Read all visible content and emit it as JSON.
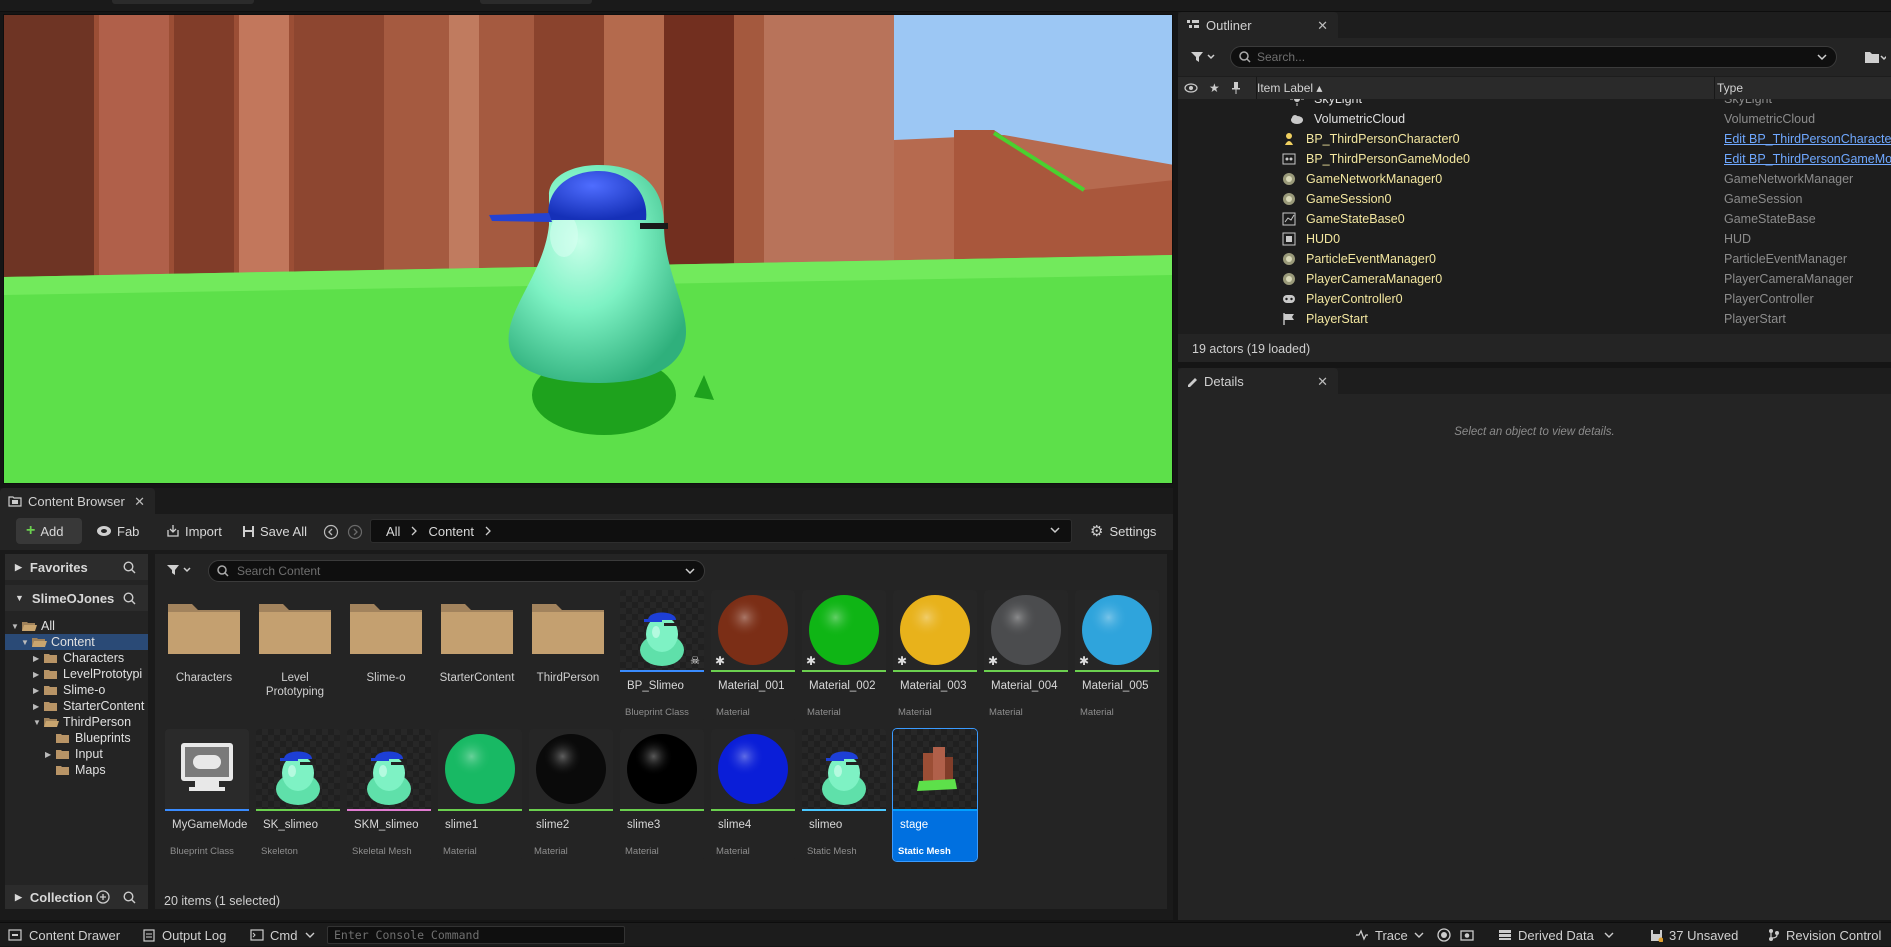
{
  "outliner": {
    "tab_label": "Outliner",
    "search_placeholder": "Search...",
    "col_item_label": "Item Label",
    "col_type": "Type",
    "rows": [
      {
        "label": "SkyLight",
        "type": "SkyLight",
        "icon": "skylight-icon"
      },
      {
        "label": "VolumetricCloud",
        "type": "VolumetricCloud",
        "icon": "cloud-icon"
      },
      {
        "label": "BP_ThirdPersonCharacter0",
        "type": "Edit BP_ThirdPersonCharacte",
        "icon": "pawn-icon",
        "link": true
      },
      {
        "label": "BP_ThirdPersonGameMode0",
        "type": "Edit BP_ThirdPersonGameMo",
        "icon": "gamemode-icon",
        "link": true
      },
      {
        "label": "GameNetworkManager0",
        "type": "GameNetworkManager",
        "icon": "actor-icon"
      },
      {
        "label": "GameSession0",
        "type": "GameSession",
        "icon": "actor-icon"
      },
      {
        "label": "GameStateBase0",
        "type": "GameStateBase",
        "icon": "gamestate-icon"
      },
      {
        "label": "HUD0",
        "type": "HUD",
        "icon": "hud-icon"
      },
      {
        "label": "ParticleEventManager0",
        "type": "ParticleEventManager",
        "icon": "actor-icon"
      },
      {
        "label": "PlayerCameraManager0",
        "type": "PlayerCameraManager",
        "icon": "actor-icon"
      },
      {
        "label": "PlayerController0",
        "type": "PlayerController",
        "icon": "gamepad-icon"
      },
      {
        "label": "PlayerStart",
        "type": "PlayerStart",
        "icon": "flag-icon"
      }
    ],
    "status": "19 actors (19 loaded)"
  },
  "details": {
    "tab_label": "Details",
    "empty_text": "Select an object to view details."
  },
  "content_browser": {
    "tab_label": "Content Browser",
    "add_label": "Add",
    "fab_label": "Fab",
    "import_label": "Import",
    "save_all_label": "Save All",
    "settings_label": "Settings",
    "path": [
      "All",
      "Content"
    ],
    "favorites_label": "Favorites",
    "project_label": "SlimeOJones",
    "collection_label": "Collection",
    "search_placeholder": "Search Content",
    "tree": [
      {
        "label": "All"
      },
      {
        "label": "Content"
      },
      {
        "label": "Characters"
      },
      {
        "label": "LevelPrototypi"
      },
      {
        "label": "Slime-o"
      },
      {
        "label": "StarterContent"
      },
      {
        "label": "ThirdPerson"
      },
      {
        "label": "Blueprints"
      },
      {
        "label": "Input"
      },
      {
        "label": "Maps"
      }
    ],
    "folders": [
      {
        "name": "Characters"
      },
      {
        "name": "Level Prototyping"
      },
      {
        "name": "Slime-o"
      },
      {
        "name": "StarterContent"
      },
      {
        "name": "ThirdPerson"
      }
    ],
    "assets_row1": [
      {
        "name": "BP_Slimeo",
        "type": "Blueprint Class"
      },
      {
        "name": "Material_001",
        "type": "Material",
        "color": "#7b2e16"
      },
      {
        "name": "Material_002",
        "type": "Material",
        "color": "#0fb515"
      },
      {
        "name": "Material_003",
        "type": "Material",
        "color": "#e8b21b"
      },
      {
        "name": "Material_004",
        "type": "Material",
        "color": "#4b4c4e"
      },
      {
        "name": "Material_005",
        "type": "Material",
        "color": "#2fa4dc"
      }
    ],
    "assets_row2": [
      {
        "name": "MyGameMode",
        "type": "Blueprint Class"
      },
      {
        "name": "SK_slimeo",
        "type": "Skeleton"
      },
      {
        "name": "SKM_slimeo",
        "type": "Skeletal Mesh"
      },
      {
        "name": "slime1",
        "type": "Material",
        "color": "#18b964"
      },
      {
        "name": "slime2",
        "type": "Material",
        "color": "#0a0a0a"
      },
      {
        "name": "slime3",
        "type": "Material",
        "color": "#000000"
      },
      {
        "name": "slime4",
        "type": "Material",
        "color": "#0a1ed8"
      },
      {
        "name": "slimeo",
        "type": "Static Mesh"
      },
      {
        "name": "stage",
        "type": "Static Mesh"
      }
    ],
    "status": "20 items (1 selected)"
  },
  "statusbar": {
    "content_drawer": "Content Drawer",
    "output_log": "Output Log",
    "cmd": "Cmd",
    "console_placeholder": "Enter Console Command",
    "trace": "Trace",
    "derived_data": "Derived Data",
    "unsaved": "37 Unsaved",
    "revision_control": "Revision Control"
  },
  "colors": {
    "accent_blue": "#0070e0",
    "ground_green": "#5de04a",
    "slime_green": "#7ef2c4",
    "cap_blue": "#1d3fd6"
  }
}
